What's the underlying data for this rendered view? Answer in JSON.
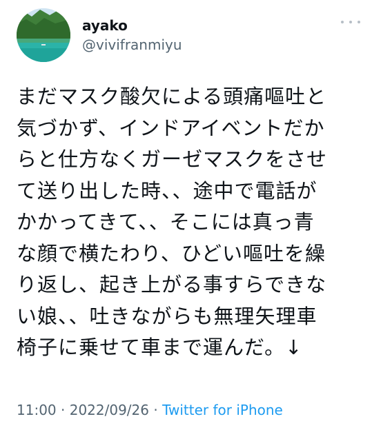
{
  "user": {
    "display_name": "ayako",
    "handle": "@vivifranmiyu",
    "avatar_icon": "lake-forest-avatar"
  },
  "tweet": {
    "text": "まだマスク酸欠による頭痛嘔吐と\n気づかず、インドアイベントだか\nらと仕方なくガーゼマスクをさせ\nて送り出した時、、途中で電話が\nかかってきて、、そこには真っ青\nな顔で横たわり、ひどい嘔吐を繰\nり返し、起き上がる事すらできな\nい娘、、吐きながらも無理矢理車\n椅子に乗せて車まで運んだ。↓"
  },
  "meta": {
    "time": "11:00",
    "separator1": " · ",
    "date": "2022/09/26",
    "separator2": " · ",
    "source": "Twitter for iPhone"
  },
  "icons": {
    "more": "more-dots-icon"
  },
  "colors": {
    "text": "#0f1419",
    "secondary": "#536471",
    "link": "#1d9bf0"
  }
}
